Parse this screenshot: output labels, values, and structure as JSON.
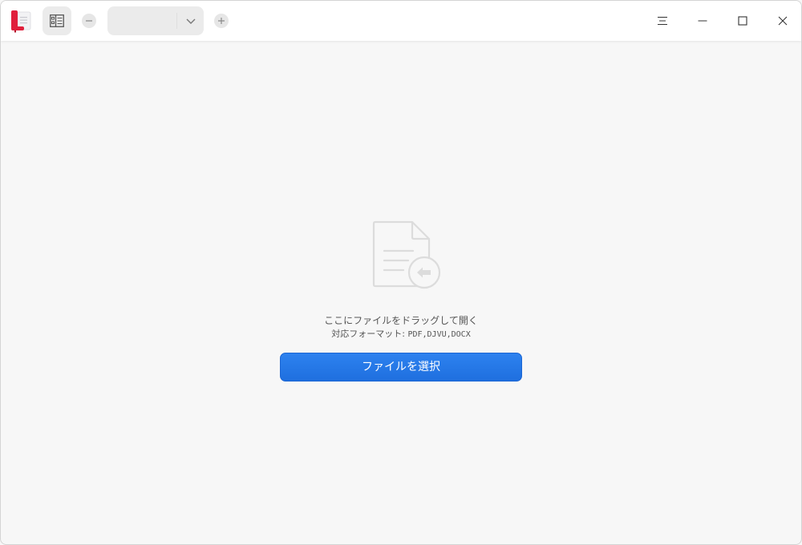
{
  "toolbar": {
    "zoom_value": ""
  },
  "empty_state": {
    "hint": "ここにファイルをドラッグして開く",
    "formats_label": "対応フォーマット: ",
    "formats": "PDF,DJVU,DOCX",
    "select_button_label": "ファイルを選択"
  },
  "icons": {
    "app_logo": "document-viewer-logo",
    "sidebar_toggle": "sidebar-toggle-icon",
    "zoom_out": "minus-icon",
    "zoom_dropdown": "chevron-down-icon",
    "zoom_in": "plus-icon",
    "menu": "hamburger-menu-icon",
    "minimize": "minimize-icon",
    "maximize": "maximize-icon",
    "close": "close-icon",
    "drop": "document-import-icon"
  },
  "colors": {
    "accent": "#2878e8",
    "logo_red": "#e0203c",
    "background": "#f7f7f7",
    "titlebar": "#ffffff"
  }
}
